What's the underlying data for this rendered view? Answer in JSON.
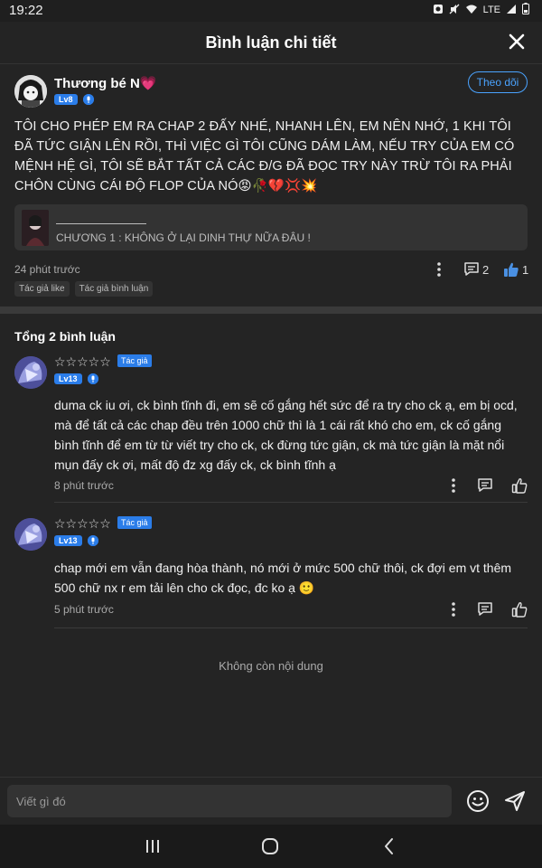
{
  "status_bar": {
    "time": "19:22",
    "network": "LTE"
  },
  "header": {
    "title": "Bình luận chi tiết"
  },
  "post": {
    "author": "Thương bé N",
    "author_emoji": "💗",
    "level": "Lv8",
    "follow_label": "Theo dõi",
    "content": "TÔI CHO PHÉP EM RA CHAP 2 ĐẤY NHÉ, NHANH LÊN, EM NÊN NHỚ, 1 KHI TÔI ĐÃ TỨC GIẬN LÊN RỒI, THÌ VIỆC GÌ TÔI CŨNG DÁM LÀM, NẾU TRY CỦA EM CÓ MỆNH HỆ GÌ, TÔI SẼ BẮT TẤT CẢ CÁC Đ/G ĐÃ ĐỌC TRY NÀY TRỪ TÔI RA PHẢI CHÔN CÙNG CÁI ĐỘ FLOP CỦA NÓ😡🥀💔💢💥",
    "chapter": "CHƯƠNG 1 : KHÔNG Ở LẠI DINH THỰ NỮA ĐÂU !",
    "time": "24 phút trước",
    "comment_count": "2",
    "like_count": "1",
    "tags": [
      "Tác giả like",
      "Tác giả bình luận"
    ]
  },
  "comments_header": "Tổng 2 bình luận",
  "comments": [
    {
      "stars": "☆☆☆☆☆",
      "author_tag": "Tác giả",
      "level": "Lv13",
      "body": "duma ck iu ơi, ck bình tĩnh đi, em sẽ cố gắng hết sức để ra try cho ck ạ, em bị ocd, mà để tất cả các chap đều trên 1000 chữ thì là 1 cái rất khó cho em, ck cố gắng bình tĩnh để em từ từ viết try cho ck, ck đừng tức giận, ck mà tức giận là mặt nổi mụn đấy ck ơi, mất độ đz xg đấy ck, ck bình tĩnh ạ",
      "time": "8 phút trước"
    },
    {
      "stars": "☆☆☆☆☆",
      "author_tag": "Tác giả",
      "level": "Lv13",
      "body": "chap mới em vẫn đang hòa thành, nó mới ở mức 500 chữ thôi, ck đợi em vt thêm 500 chữ nx r em tải lên cho ck đọc, đc ko ạ 🙂",
      "time": "5 phút trước"
    }
  ],
  "no_more": "Không còn nội dung",
  "composer": {
    "placeholder": "Viết gì đó"
  },
  "colors": {
    "accent": "#2b7de9",
    "follow": "#4aa3ff",
    "background": "#242424"
  }
}
